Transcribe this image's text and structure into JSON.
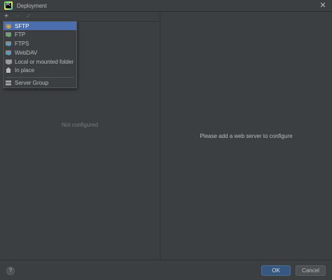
{
  "window": {
    "title": "Deployment",
    "logo_text": "PC",
    "close_glyph": "✕"
  },
  "toolbar": {
    "add_glyph": "+",
    "remove_glyph": "−",
    "apply_glyph": "✓"
  },
  "popup": {
    "items": [
      {
        "label": "SFTP",
        "icon": "sftp-server-icon",
        "selected": true
      },
      {
        "label": "FTP",
        "icon": "ftp-server-icon",
        "selected": false
      },
      {
        "label": "FTPS",
        "icon": "ftps-server-icon",
        "selected": false
      },
      {
        "label": "WebDAV",
        "icon": "webdav-server-icon",
        "selected": false
      },
      {
        "label": "Local or mounted folder",
        "icon": "folder-icon",
        "selected": false
      },
      {
        "label": "In place",
        "icon": "home-icon",
        "selected": false
      },
      {
        "label": "Server Group",
        "icon": "server-group-icon",
        "selected": false
      }
    ]
  },
  "left_panel": {
    "empty_text": "Not configured"
  },
  "right_panel": {
    "empty_text": "Please add a web server to configure"
  },
  "footer": {
    "help_glyph": "?",
    "ok_label": "OK",
    "cancel_label": "Cancel"
  },
  "colors": {
    "background": "#3c3f41",
    "selection": "#4b6eaf",
    "ok_button": "#365880"
  }
}
